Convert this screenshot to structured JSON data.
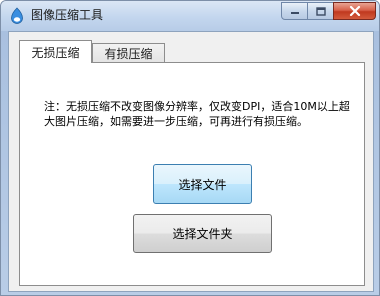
{
  "window": {
    "title": "图像压缩工具",
    "icons": {
      "app": "app-logo-icon",
      "minimize": "minimize-icon",
      "maximize": "maximize-icon",
      "close": "close-icon"
    }
  },
  "tabs": [
    {
      "label": "无损压缩",
      "active": true
    },
    {
      "label": "有损压缩",
      "active": false
    }
  ],
  "panel": {
    "note": "注：无损压缩不改变图像分辨率，仅改变DPI，适合10M以上超大图片压缩，如需要进一步压缩，可再进行有损压缩。",
    "select_file_label": "选择文件",
    "select_folder_label": "选择文件夹"
  }
}
